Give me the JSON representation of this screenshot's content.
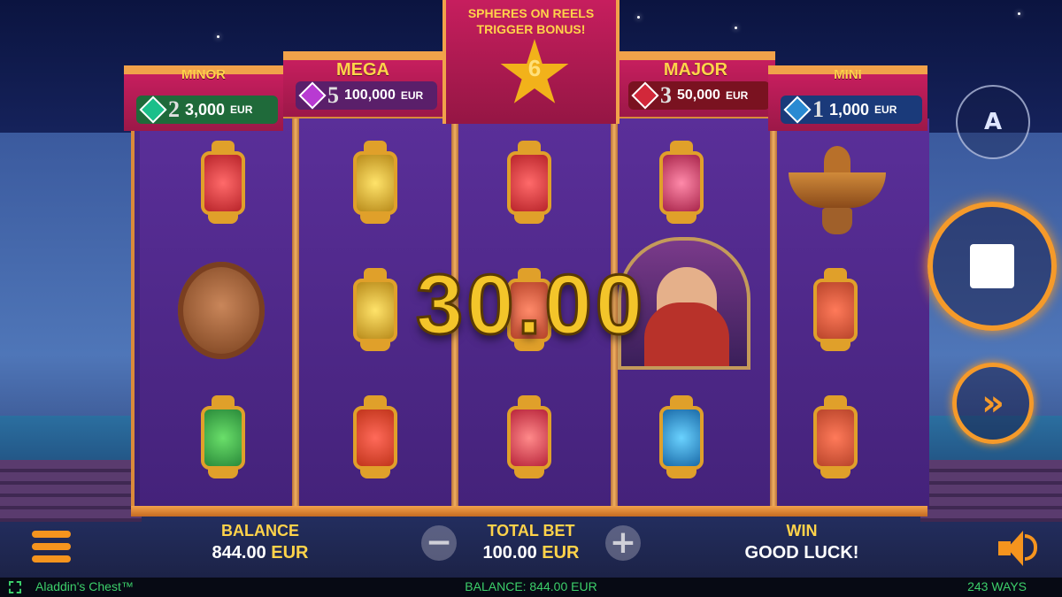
{
  "jackpots": [
    {
      "name": "MINOR",
      "count": "2",
      "amount": "3,000",
      "currency": "EUR",
      "gem_color": "#1bbf8a",
      "pill_color": "#1f6a3a"
    },
    {
      "name": "MEGA",
      "count": "5",
      "amount": "100,000",
      "currency": "EUR",
      "gem_color": "#b83ad2",
      "pill_color": "#5a1f6a"
    },
    {
      "name": "MAJOR",
      "count": "3",
      "amount": "50,000",
      "currency": "EUR",
      "gem_color": "#d2283a",
      "pill_color": "#7a1220"
    },
    {
      "name": "MINI",
      "count": "1",
      "amount": "1,000",
      "currency": "EUR",
      "gem_color": "#2a8ad2",
      "pill_color": "#1a3a7a"
    }
  ],
  "bonus": {
    "line1": "SPHERES ON REELS",
    "line2": "TRIGGER BONUS!",
    "count": "6"
  },
  "win_display": "30.00",
  "symbols": {
    "lantern_red": "lantern-red",
    "lantern_yellow": "lantern-yellow",
    "lantern_green": "lantern-green",
    "lantern_blue": "lantern-blue",
    "lion": "lion-head",
    "lamp": "magic-lamp",
    "lady": "veiled-woman"
  },
  "bottom": {
    "balance_label": "BALANCE",
    "balance_value": "844.00",
    "balance_currency": "EUR",
    "total_bet_label": "TOTAL BET",
    "total_bet_value": "100.00",
    "total_bet_currency": "EUR",
    "minus": "−",
    "plus": "+",
    "win_label": "WIN",
    "win_value": "GOOD LUCK!"
  },
  "buttons": {
    "autoplay": "A",
    "turbo": "»"
  },
  "status_bar": {
    "game_title": "Aladdin's Chest™",
    "balance": "BALANCE: 844.00 EUR",
    "ways": "243 WAYS"
  },
  "colors": {
    "accent": "#f59a2a",
    "gold": "#ffd34a",
    "status": "#3ccf6a"
  }
}
